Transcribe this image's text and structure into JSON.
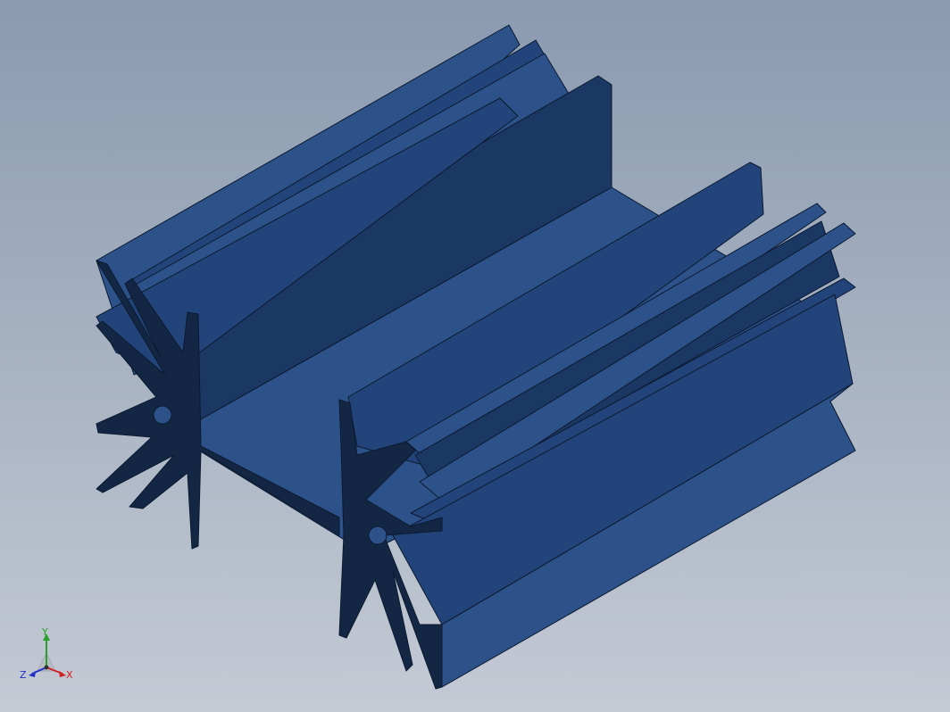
{
  "viewport": {
    "background_top": "#8a9ab0",
    "background_bottom": "#c4cad4",
    "model": {
      "part": "heatsink-extrusion",
      "color_light": "#2d5189",
      "color_mid": "#23447a",
      "color_dark": "#1b3763",
      "color_end_face": "#132745",
      "edge_color": "#0b1a30"
    }
  },
  "triad": {
    "y_label": "Y",
    "x_label": "X",
    "z_label": "Z",
    "y_color": "#2aa02a",
    "x_color": "#d42020",
    "z_color": "#2030c8"
  }
}
